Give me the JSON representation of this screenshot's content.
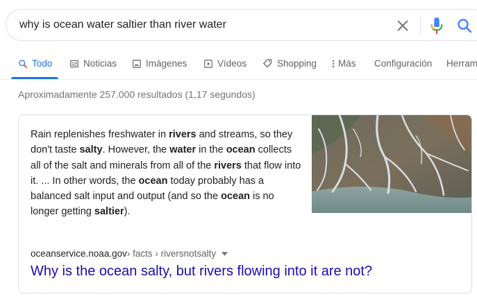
{
  "search": {
    "query": "why is ocean water saltier than river water"
  },
  "tabs": [
    {
      "label": "Todo",
      "icon": "search-icon",
      "active": true
    },
    {
      "label": "Noticias",
      "icon": "news-icon"
    },
    {
      "label": "Imágenes",
      "icon": "image-icon"
    },
    {
      "label": "Vídeos",
      "icon": "video-icon"
    },
    {
      "label": "Shopping",
      "icon": "tag-icon"
    },
    {
      "label": "Más",
      "icon": "more-vert-icon"
    },
    {
      "label": "Configuración"
    },
    {
      "label": "Herram"
    }
  ],
  "result_stats": "Aproximadamente 257.000 resultados (1,17 segundos)",
  "featured_snippet": {
    "segments": [
      {
        "t": "Rain replenishes freshwater in ",
        "b": false
      },
      {
        "t": "rivers",
        "b": true
      },
      {
        "t": " and streams, so they don't taste ",
        "b": false
      },
      {
        "t": "salty",
        "b": true
      },
      {
        "t": ". However, the ",
        "b": false
      },
      {
        "t": "water",
        "b": true
      },
      {
        "t": " in the ",
        "b": false
      },
      {
        "t": "ocean",
        "b": true
      },
      {
        "t": " collects all of the salt and minerals from all of the ",
        "b": false
      },
      {
        "t": "rivers",
        "b": true
      },
      {
        "t": " that flow into it. ... In other words, the ",
        "b": false
      },
      {
        "t": "ocean",
        "b": true
      },
      {
        "t": " today probably has a balanced salt input and output (and so the ",
        "b": false
      },
      {
        "t": "ocean",
        "b": true
      },
      {
        "t": " is no longer getting ",
        "b": false
      },
      {
        "t": "saltier",
        "b": true
      },
      {
        "t": ").",
        "b": false
      }
    ],
    "cite_domain": "oceanservice.noaa.gov",
    "cite_path": " › facts › riversnotsalty",
    "title": "Why is the ocean salty, but rivers flowing into it are not?"
  },
  "colors": {
    "accent": "#1a73e8",
    "link": "#1a0dab",
    "muted": "#70757a"
  }
}
